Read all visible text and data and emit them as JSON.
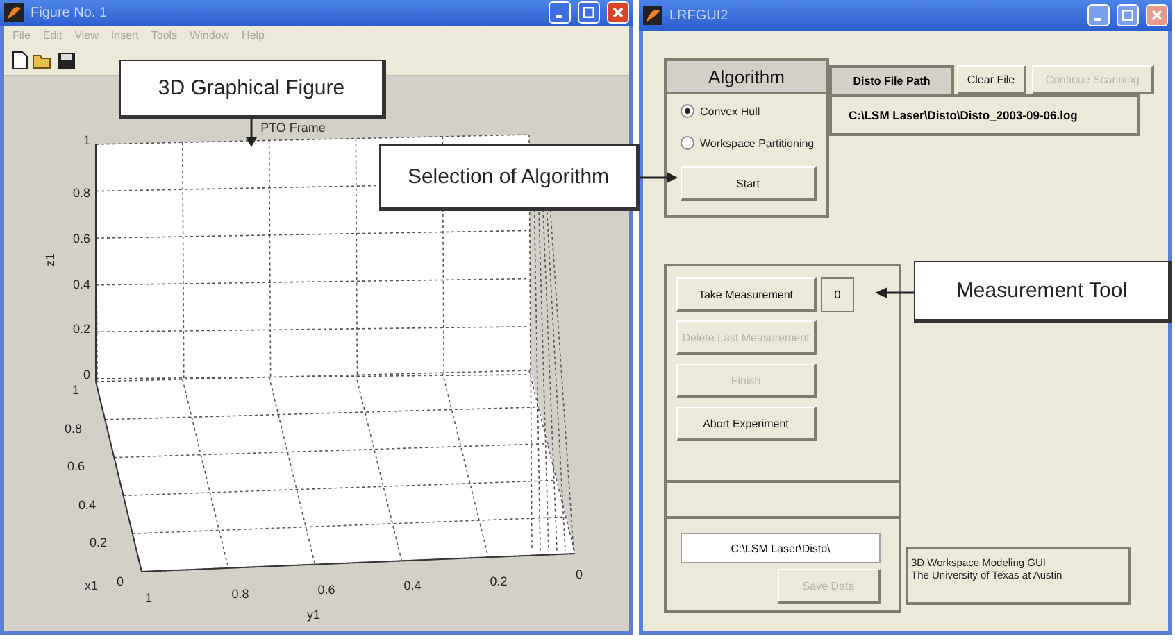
{
  "figure_window": {
    "title": "Figure No. 1",
    "menu": [
      "File",
      "Edit",
      "View",
      "Insert",
      "Tools",
      "Window",
      "Help"
    ],
    "plot": {
      "title": "PTO Frame",
      "zlabel": "z1",
      "xlabel": "x1",
      "ylabel": "y1",
      "z_ticks": [
        "1",
        "0.8",
        "0.6",
        "0.4",
        "0.2",
        "0"
      ],
      "x_ticks": [
        "1",
        "0.8",
        "0.6",
        "0.4",
        "0.2",
        "0"
      ],
      "y_ticks": [
        "1",
        "0.8",
        "0.6",
        "0.4",
        "0.2",
        "0"
      ]
    }
  },
  "gui_window": {
    "title": "LRFGUI2",
    "algorithm": {
      "title": "Algorithm",
      "options": [
        {
          "label": "Convex Hull",
          "selected": true
        },
        {
          "label": "Workspace Partitioning",
          "selected": false
        }
      ],
      "start_button": "Start"
    },
    "file": {
      "label": "Disto File Path",
      "path": "C:\\LSM Laser\\Disto\\Disto_2003-09-06.log",
      "buttons": [
        {
          "label": "Clear File",
          "disabled": false
        },
        {
          "label": "Continue Scanning",
          "disabled": true
        }
      ]
    },
    "measurement": {
      "count": "0",
      "buttons": [
        {
          "label": "Take Measurement",
          "disabled": false
        },
        {
          "label": "Delete Last Measurement",
          "disabled": true
        },
        {
          "label": "Finish",
          "disabled": true
        },
        {
          "label": "Abort Experiment",
          "disabled": false
        }
      ]
    },
    "save": {
      "path": "C:\\LSM Laser\\Disto\\",
      "button": {
        "label": "Save Data",
        "disabled": true
      }
    },
    "info": [
      "3D Workspace Modeling GUI",
      "The University of Texas at Austin"
    ]
  },
  "callouts": [
    {
      "text": "3D Graphical Figure"
    },
    {
      "text": "Selection of Algorithm"
    },
    {
      "text": "Measurement Tool"
    }
  ]
}
